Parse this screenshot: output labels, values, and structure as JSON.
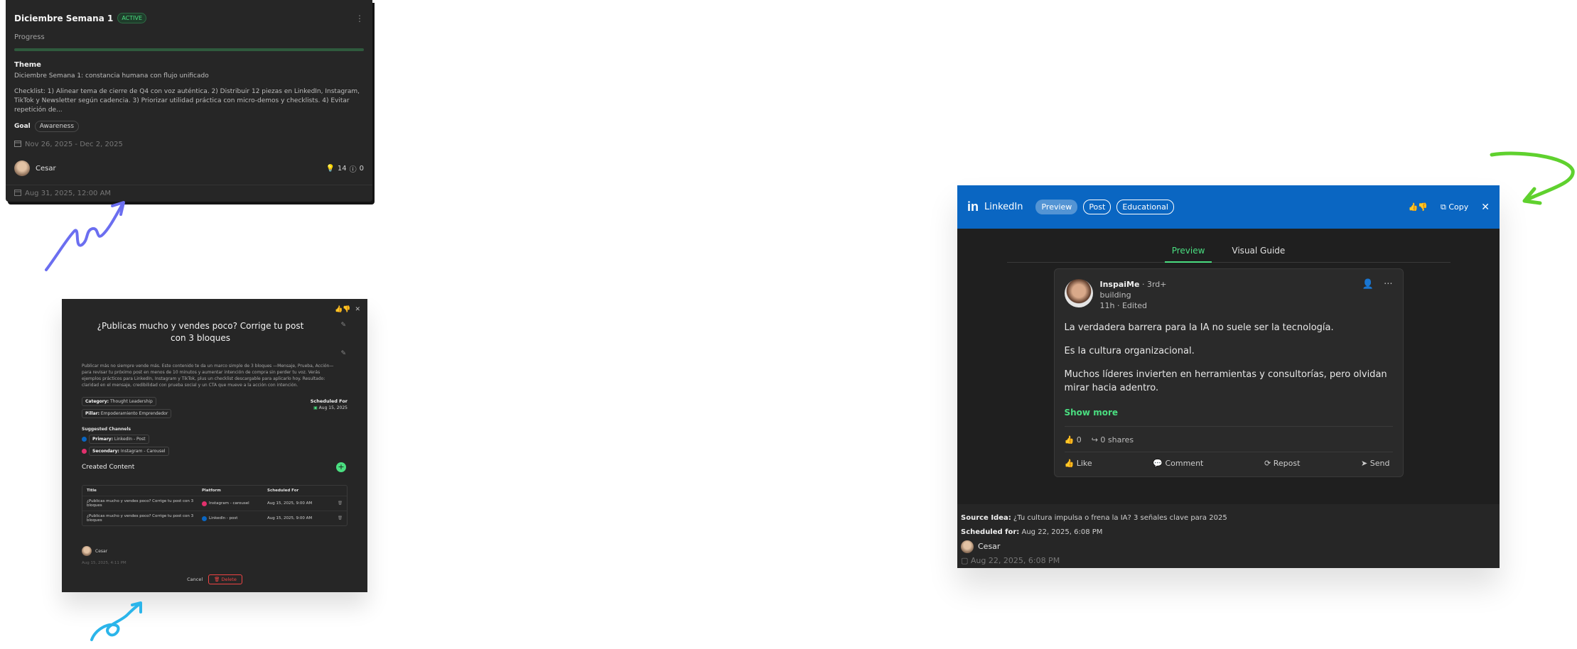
{
  "campaign": {
    "title": "Diciembre Semana 1",
    "status": "ACTIVE",
    "progress_label": "Progress",
    "progress_fraction": 1.0,
    "theme_label": "Theme",
    "theme_text": "Diciembre Semana 1: constancia humana con flujo unificado",
    "checklist": "Checklist: 1) Alinear tema de cierre de Q4 con voz auténtica. 2) Distribuir 12 piezas en LinkedIn, Instagram, TikTok y Newsletter según cadencia. 3) Priorizar utilidad práctica con micro-demos y checklists. 4) Evitar repetición de...",
    "goal_label": "Goal",
    "goal_value": "Awareness",
    "date_range": "Nov 26, 2025 - Dec 2, 2025",
    "user": "Cesar",
    "ideas_count": "14",
    "info_count": "0",
    "created": "Aug 31, 2025, 12:00 AM"
  },
  "idea_dialog": {
    "title": "¿Publicas mucho y vendes poco? Corrige tu post con 3 bloques",
    "description": "Publicar más no siempre vende más. Este contenido te da un marco simple de 3 bloques —Mensaje, Prueba, Acción— para revisar tu próximo post en menos de 10 minutos y aumentar intención de compra sin perder tu voz. Verás ejemplos prácticos para LinkedIn, Instagram y TikTok, plus un checklist descargable para aplicarlo hoy. Resultado: claridad en el mensaje, credibilidad con prueba social y un CTA que mueve a la acción con intención.",
    "category_label": "Category:",
    "category": "Thought Leadership",
    "pillar_label": "Pillar:",
    "pillar": "Empoderamiento Emprendedor",
    "scheduled_label": "Scheduled For",
    "scheduled_date": "Aug 15, 2025",
    "channels_label": "Suggested Channels",
    "primary_label": "Primary:",
    "primary_value": "LinkedIn - Post",
    "secondary_label": "Secondary:",
    "secondary_value": "Instagram - Carousel",
    "created_content_label": "Created Content",
    "table_headers": [
      "Title",
      "Platform",
      "Scheduled For"
    ],
    "rows": [
      {
        "title": "¿Publicas mucho y vendes poco? Corrige tu post con 3 bloques",
        "platform": "Instagram - carousel",
        "scheduled": "Aug 15, 2025, 9:00 AM",
        "color": "#e1306c"
      },
      {
        "title": "¿Publicas mucho y vendes poco? Corrige tu post con 3 bloques",
        "platform": "LinkedIn - post",
        "scheduled": "Aug 15, 2025, 9:00 AM",
        "color": "#0a66c2"
      }
    ],
    "user": "Cesar",
    "created": "Aug 15, 2025, 4:11 PM",
    "cancel_label": "Cancel",
    "delete_label": "Delete"
  },
  "linkedin": {
    "brand": "LinkedIn",
    "pills": [
      "Preview",
      "Post",
      "Educational"
    ],
    "copy_label": "Copy",
    "tabs": [
      "Preview",
      "Visual Guide"
    ],
    "author": "InspaiMe",
    "degree": "· 3rd+",
    "headline": "building",
    "time": "11h",
    "edited": "Edited",
    "paragraphs": [
      "La verdadera barrera para la IA no suele ser la tecnología.",
      "Es la cultura organizacional.",
      "Muchos líderes invierten en herramientas y consultorías, pero olvidan mirar hacia adentro."
    ],
    "show_more": "Show more",
    "likes": "0",
    "shares": "0 shares",
    "actions": [
      "Like",
      "Comment",
      "Repost",
      "Send"
    ],
    "source_label": "Source Idea:",
    "source_value": "¿Tu cultura impulsa o frena la IA? 3 señales clave para 2025",
    "scheduled_label": "Scheduled for:",
    "scheduled_value": "Aug 22, 2025, 6:08 PM",
    "user": "Cesar",
    "created": "Aug 22, 2025, 6:08 PM"
  },
  "colors": {
    "accent_green": "#4ade80",
    "linkedin_blue": "#0a66c2",
    "arrow_purple": "#6b6ef0",
    "arrow_cyan": "#2bb5ea",
    "arrow_green": "#5fd12e",
    "card_bg": "#262626"
  }
}
